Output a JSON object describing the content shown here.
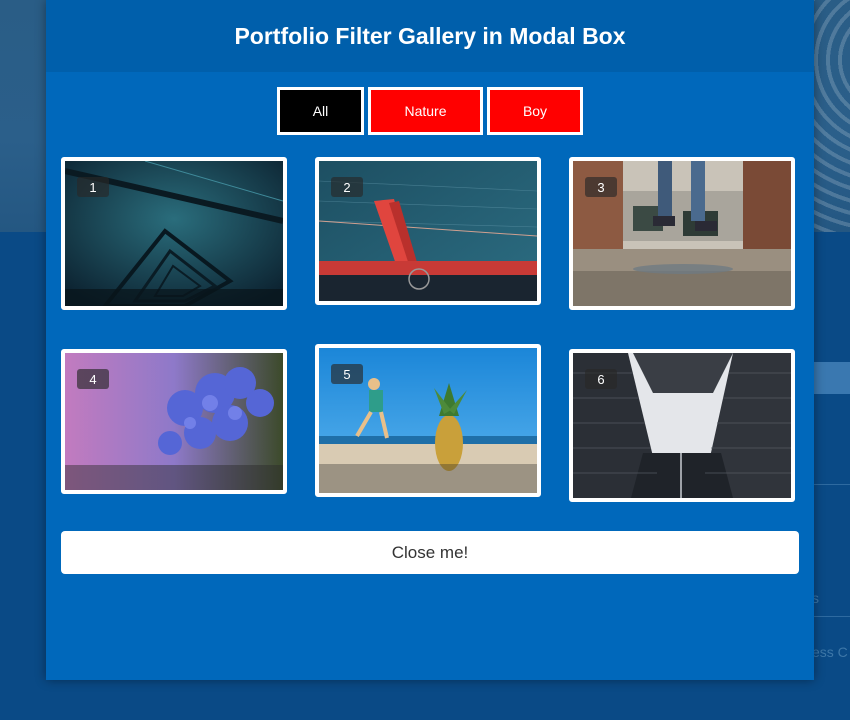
{
  "modal": {
    "title": "Portfolio Filter Gallery in Modal Box",
    "close_label": "Close me!"
  },
  "filters": [
    {
      "label": "All",
      "active": true,
      "color": "#000000"
    },
    {
      "label": "Nature",
      "active": false,
      "color": "#ff0000"
    },
    {
      "label": "Boy",
      "active": false,
      "color": "#ff0000"
    }
  ],
  "gallery": [
    {
      "number": "1",
      "subject": "geometric bridge tunnel"
    },
    {
      "number": "2",
      "subject": "aerial red bridge over water"
    },
    {
      "number": "3",
      "subject": "jumping legs over puddle"
    },
    {
      "number": "4",
      "subject": "purple flowers"
    },
    {
      "number": "5",
      "subject": "child running beside pineapple on beach"
    },
    {
      "number": "6",
      "subject": "skyscrapers from below"
    }
  ],
  "background": {
    "snippet_a": "s",
    "snippet_b": "ess C"
  },
  "colors": {
    "modal_bg": "#0068bb",
    "header_bg": "#005fab",
    "filter_active": "#000000",
    "filter_inactive": "#ff0000"
  }
}
